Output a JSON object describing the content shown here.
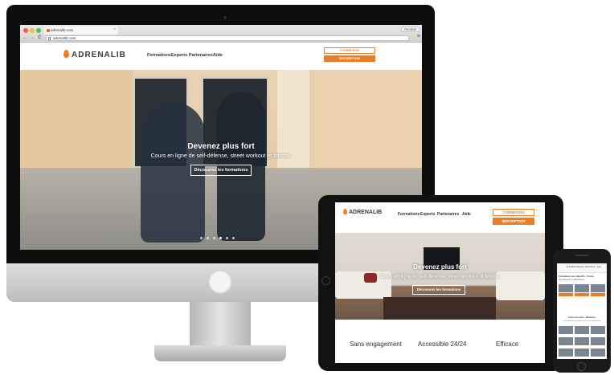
{
  "desktop": {
    "browser": {
      "tab_title": "adrenalib.com",
      "user_name": "Nicolas",
      "url": "adrenalib.com",
      "back_icon": "←",
      "forward_icon": "→",
      "reload_icon": "C",
      "star_icon": "☆",
      "menu_icon": "≡"
    },
    "site": {
      "logo": "ADRENALIB",
      "nav": [
        "Formations",
        "Experts",
        "Partenaires",
        "Aide"
      ],
      "connexion_label": "CONNEXION",
      "inscription_label": "INSCRIPTION",
      "hero_title": "Devenez plus fort",
      "hero_subtitle": "Cours en ligne de self-défense, street workout et fitness.",
      "hero_button": "Découvrez les formations"
    }
  },
  "tablet": {
    "logo": "ADRENALIB",
    "nav": [
      "Formations",
      "Experts",
      "Partenaires",
      "Aide"
    ],
    "connexion_label": "CONNEXION",
    "inscription_label": "INSCRIPTION",
    "hero_title": "Devenez plus fort",
    "hero_subtitle": "Cours en ligne de self-défense, street workout et fitness.",
    "hero_button": "Découvrez les formations",
    "features": [
      "Sans engagement",
      "Accessible 24/24",
      "Efficace"
    ]
  },
  "phone": {
    "nav": [
      "Formations",
      "Experts",
      "Partenaires",
      "Aide"
    ],
    "title": "Formations par objectifs - 3 mois",
    "subtitle": "Pour atteindre un objectif avec",
    "section_title": "Cours à la carte - 39 heures",
    "section_subtitle": "Pour améliorer le travail avec un ou plusieurs de"
  },
  "colors": {
    "accent": "#ee7c23",
    "device_frame": "#0d0d0d"
  }
}
